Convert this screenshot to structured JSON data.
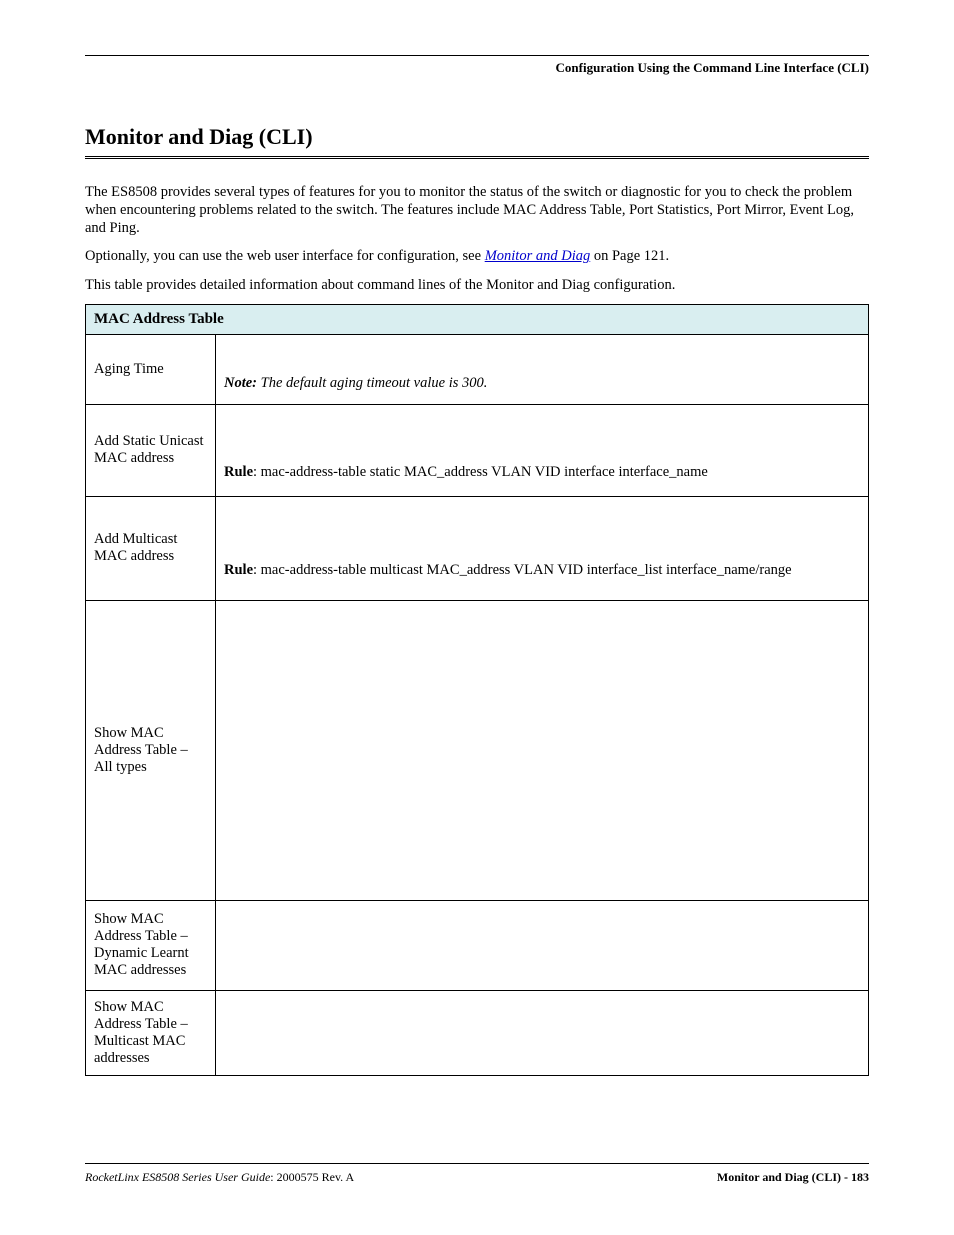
{
  "running_head": "Configuration Using the Command Line Interface (CLI)",
  "title": "Monitor and Diag (CLI)",
  "para1": "The ES8508 provides several types of features for you to monitor the status of the switch or diagnostic for you to check the problem when encountering problems related to the switch. The features include MAC Address Table, Port Statistics, Port Mirror, Event Log, and Ping.",
  "para2_pre": "Optionally, you can use the web user interface for configuration, see ",
  "para2_link": "Monitor and Diag",
  "para2_post": " on Page 121.",
  "para3": "This table provides detailed information about command lines of the Monitor and Diag configuration.",
  "table": {
    "header": "MAC Address Table",
    "rows": [
      {
        "label": "Aging Time",
        "note_label": "Note: ",
        "note_body": "The default aging timeout value is 300.",
        "row_class": "row-h0"
      },
      {
        "label": "Add Static Unicast MAC address",
        "rule_label": "Rule",
        "rule_body": ": mac-address-table static MAC_address VLAN VID interface interface_name",
        "row_class": "row-h1"
      },
      {
        "label": "Add Multicast MAC address",
        "rule_label": "Rule",
        "rule_body": ": mac-address-table multicast MAC_address VLAN VID interface_list interface_name/range",
        "row_class": "row-h2"
      },
      {
        "label": "Show MAC Address Table – All types",
        "row_class": "row-h3"
      },
      {
        "label": "Show MAC Address Table – Dynamic Learnt MAC addresses",
        "row_class": "row-h4"
      },
      {
        "label": "Show MAC Address Table – Multicast MAC addresses",
        "row_class": "row-h5"
      }
    ]
  },
  "footer": {
    "left_italic": "RocketLinx ES8508 Series  User Guide",
    "left_rest": ": 2000575 Rev. A",
    "right": "Monitor and Diag (CLI) - 183"
  }
}
